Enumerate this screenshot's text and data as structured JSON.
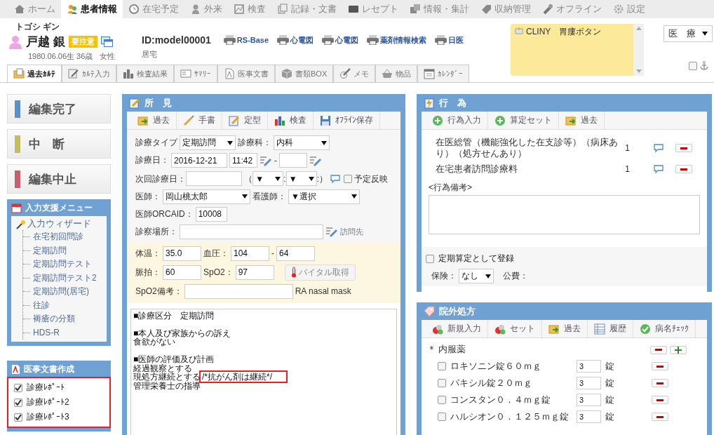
{
  "nav": [
    {
      "label": "ホーム",
      "selected": false
    },
    {
      "label": "患者情報",
      "selected": true
    },
    {
      "label": "在宅予定",
      "selected": false
    },
    {
      "label": "外来",
      "selected": false
    },
    {
      "label": "検査",
      "selected": false
    },
    {
      "label": "記録・文書",
      "selected": false
    },
    {
      "label": "レセプト",
      "selected": false
    },
    {
      "label": "情報・集計",
      "selected": false
    },
    {
      "label": "収納管理",
      "selected": false
    },
    {
      "label": "オフライン",
      "selected": false
    },
    {
      "label": "設定",
      "selected": false
    }
  ],
  "patient": {
    "kana": "トゴシ ギン",
    "name": "戸越 銀",
    "badge": "要注意",
    "birth": "1980.06.06生 36歳",
    "sex": "女性",
    "id": "ID:model00001",
    "residence": "居宅"
  },
  "links": [
    "RS-Base",
    "心電図",
    "心電図",
    "薬剤情報検索",
    "日医"
  ],
  "memo": {
    "text": "CLINY　胃瘻ボタン"
  },
  "category_select": {
    "value": "医　療"
  },
  "pin_checkbox": {
    "checked": false
  },
  "tabs": [
    {
      "label": "過去ｶﾙﾃ",
      "selected": true
    },
    {
      "label": "ｶﾙﾃ入力",
      "selected": false
    },
    {
      "label": "検査結果",
      "selected": false
    },
    {
      "label": "ｻﾏﾘｰ",
      "selected": false
    },
    {
      "label": "医事文書",
      "selected": false
    },
    {
      "label": "書類BOX",
      "selected": false
    },
    {
      "label": "メモ",
      "selected": false
    },
    {
      "label": "物品",
      "selected": false
    },
    {
      "label": "ｶﾚﾝﾀﾞｰ",
      "selected": false
    }
  ],
  "actions": [
    {
      "label": "編集完了",
      "color": "#5b8fcb"
    },
    {
      "label": "中　断",
      "color": "#c4bc62"
    },
    {
      "label": "編集中止",
      "color": "#c95d70"
    }
  ],
  "input_menu": {
    "title": "入力支援メニュー",
    "items": [
      {
        "label": "入力ウィザード",
        "children": [
          {
            "label": "在宅初回問診"
          },
          {
            "label": "定期訪問"
          },
          {
            "label": "定期訪問テスト"
          },
          {
            "label": "定期訪問テスト2"
          },
          {
            "label": "定期訪問(居宅)"
          },
          {
            "label": "往診"
          },
          {
            "label": "褥瘡の分類"
          },
          {
            "label": "HDS-R"
          }
        ]
      }
    ]
  },
  "documents": {
    "title": "医事文書作成",
    "highlighted": true,
    "items": [
      {
        "label": "診療ﾚﾎﾟｰﾄ",
        "checked": true
      },
      {
        "label": "診療ﾚﾎﾟｰﾄ2",
        "checked": true
      },
      {
        "label": "診療ﾚﾎﾟｰﾄ3",
        "checked": true
      }
    ]
  },
  "findings": {
    "title": "所　見",
    "toolbar": [
      "過去",
      "手書",
      "定型",
      "検査",
      "ｵﾌﾗｲﾝ保存"
    ],
    "visit_type": {
      "label": "診療タイプ",
      "value": "定期訪問"
    },
    "department": {
      "label": "診療科：",
      "value": "内科"
    },
    "date": {
      "label": "診療日：",
      "value": "2016-12-21",
      "time": "11:42",
      "dash": "-"
    },
    "next_date": {
      "label": "次回診療日：",
      "open": "（",
      "hour": "▼",
      "sep": ":",
      "minute": "▼",
      "close": ":）"
    },
    "reserve": {
      "label": "予定反映",
      "checked": false
    },
    "doctor": {
      "label": "医師：",
      "value": "岡山桃太郎"
    },
    "nurse": {
      "label": "看護師：",
      "value": "▼選択"
    },
    "orca_id": {
      "label": "医師ORCAID：",
      "value": "10008"
    },
    "place": {
      "label": "診察場所：",
      "link": "訪問先"
    },
    "vitals": {
      "temp_label": "体温：",
      "temp": "35.0",
      "bp_label": "血圧：",
      "bp_high": "104",
      "bp_dash": "-",
      "bp_low": "64",
      "pulse_label": "脈拍：",
      "pulse": "60",
      "spo2_label": "SpO2：",
      "spo2": "97",
      "button": "バイタル取得",
      "note_label": "SpO2備考：",
      "note": "RA nasal mask"
    },
    "note": [
      [
        {
          "text": "■診療区分　定期訪問"
        }
      ],
      [
        {
          "text": "■本人及び家族からの訴え"
        },
        {
          "text": "食欲がない"
        }
      ],
      [
        {
          "text": "■医師の評価及び計画"
        },
        {
          "text": "経過観察とする"
        },
        {
          "text": "現処方継続とする",
          "highlight": "/*抗がん剤は継続*/"
        },
        {
          "text": "管理栄養士の指導"
        }
      ]
    ]
  },
  "acts": {
    "title": "行　為",
    "toolbar": [
      "行為入力",
      "算定セット",
      "過去"
    ],
    "items": [
      {
        "name": "在医総管（機能強化した在支診等）（病床あり）（処方せんあり）",
        "count": "1"
      },
      {
        "name": "在宅患者訪問診療料",
        "count": "1"
      }
    ],
    "remarks_label": "<行為備考>",
    "periodic": {
      "label": "定期算定として登録",
      "checked": false
    },
    "insurance": {
      "label": "保険：",
      "value": "なし"
    },
    "public_label": "公費："
  },
  "prescription": {
    "title": "院外処方",
    "toolbar": [
      "新規入力",
      "セット",
      "過去",
      "履歴",
      "病名ﾁｪｯｸ"
    ],
    "group": "＊ 内服薬",
    "drugs": [
      {
        "name": "ロキソニン錠６０ｍｇ",
        "qty": "3",
        "unit": "錠",
        "checked": false
      },
      {
        "name": "パキシル錠２０ｍｇ",
        "qty": "3",
        "unit": "錠",
        "checked": false
      },
      {
        "name": "コンスタン０．４ｍｇ錠",
        "qty": "3",
        "unit": "錠",
        "checked": false
      },
      {
        "name": "ハルシオン０．１２５ｍｇ錠",
        "qty": "3",
        "unit": "錠",
        "checked": false
      }
    ]
  }
}
